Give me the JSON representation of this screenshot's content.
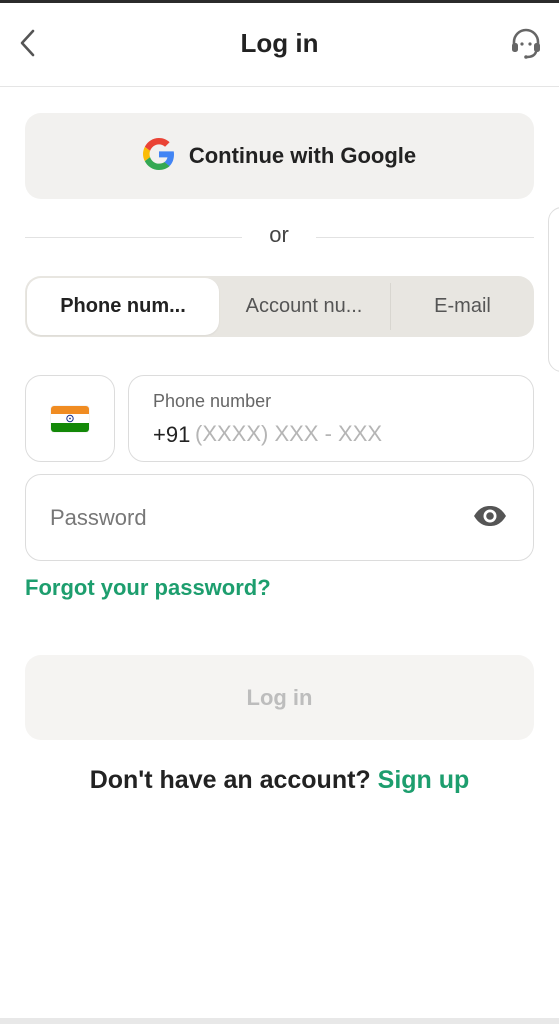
{
  "header": {
    "title": "Log in",
    "back_icon": "chevron-left-icon",
    "support_icon": "headset-icon"
  },
  "google": {
    "label": "Continue with Google",
    "icon": "google-icon"
  },
  "divider": {
    "text": "or"
  },
  "tabs": [
    {
      "label": "Phone num...",
      "active": true
    },
    {
      "label": "Account nu...",
      "active": false
    },
    {
      "label": "E-mail",
      "active": false
    }
  ],
  "phone": {
    "country_flag": "india-flag-icon",
    "label": "Phone number",
    "prefix": "+91",
    "placeholder": "(XXXX) XXX - XXX",
    "value": ""
  },
  "password": {
    "placeholder": "Password",
    "value": "",
    "visibility_icon": "eye-icon"
  },
  "forgot": {
    "label": "Forgot your password?"
  },
  "login": {
    "label": "Log in"
  },
  "signup": {
    "prompt": "Don't have an account?",
    "link": "Sign up"
  },
  "colors": {
    "accent_green": "#1d9e6e",
    "button_bg": "#f2f1ef",
    "tab_bg": "#e8e6e1",
    "flag_saffron": "#f08c22",
    "flag_green": "#138808",
    "flag_chakra": "#1a2e8a"
  }
}
